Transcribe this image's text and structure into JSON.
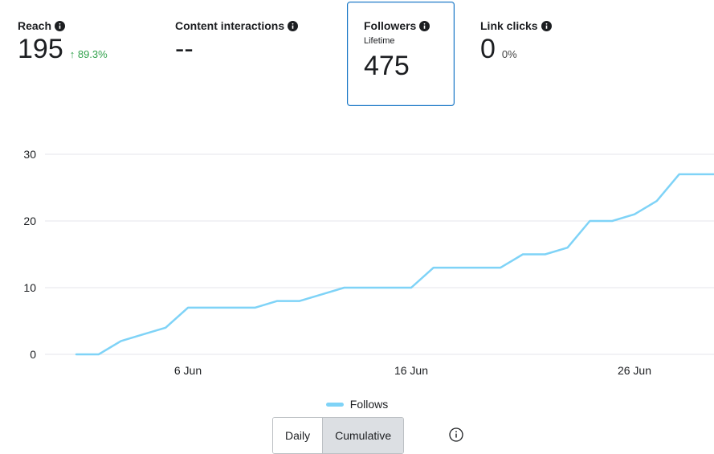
{
  "metrics": {
    "reach": {
      "title": "Reach",
      "value": "195",
      "change": "↑ 89.3%"
    },
    "interactions": {
      "title": "Content interactions",
      "value": "--"
    },
    "followers": {
      "title": "Followers",
      "sublabel": "Lifetime",
      "value": "475"
    },
    "links": {
      "title": "Link clicks",
      "value": "0",
      "change": "0%"
    }
  },
  "colors": {
    "series": "#7fd3f7",
    "grid": "#e4e6eb",
    "selected_border": "#1877c5",
    "positive": "#31a24c"
  },
  "chart_data": {
    "type": "line",
    "xlabel": "",
    "ylabel": "",
    "ylim": [
      0,
      30
    ],
    "yticks": [
      "0",
      "10",
      "20",
      "30"
    ],
    "grid": true,
    "xticks": [
      "6 Jun",
      "16 Jun",
      "26 Jun"
    ],
    "xtick_days": [
      6,
      16,
      26
    ],
    "legend_position": "bottom",
    "series": [
      {
        "name": "Follows",
        "x": [
          1,
          2,
          3,
          4,
          5,
          6,
          7,
          8,
          9,
          10,
          11,
          12,
          13,
          14,
          15,
          16,
          17,
          18,
          19,
          20,
          21,
          22,
          23,
          24,
          25,
          26,
          27,
          28,
          29,
          30
        ],
        "values": [
          0,
          0,
          2,
          3,
          4,
          7,
          7,
          7,
          7,
          8,
          8,
          9,
          10,
          10,
          10,
          10,
          13,
          13,
          13,
          13,
          15,
          15,
          16,
          20,
          20,
          21,
          23,
          27,
          27,
          27
        ]
      }
    ]
  },
  "toggle": {
    "daily": "Daily",
    "cumulative": "Cumulative",
    "active": "cumulative"
  }
}
